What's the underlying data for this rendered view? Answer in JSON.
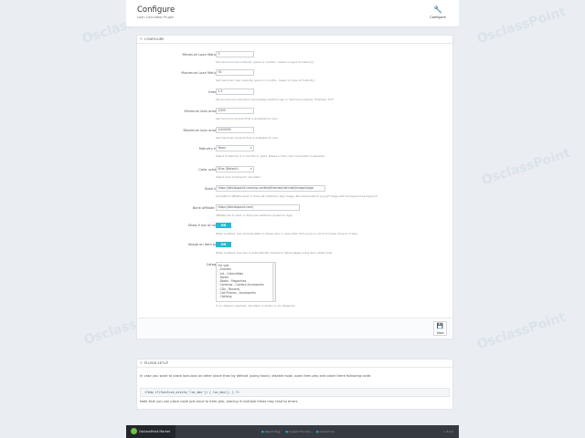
{
  "header": {
    "title": "Configure",
    "subtitle": "Loan Calculator Plugin",
    "configure_button": "Configure",
    "configure_icon": "wrench-icon"
  },
  "config": {
    "panel_title": "CONFIGURE",
    "fields": {
      "min_maturity": {
        "label": "Minimum Loan Maturity",
        "value": "5",
        "help": "Set minimum loan maturity (years or months - based on type of maturity)"
      },
      "max_maturity": {
        "label": "Maximum Loan Maturity",
        "value": "30",
        "help": "Set maximum loan maturity (years or months - based on type of maturity)"
      },
      "interest": {
        "label": "Interest",
        "value": "1.5",
        "help": "Set annual loan interest in percentage (without sign or decimal numbers). Example: 5.67"
      },
      "min_amount": {
        "label": "Minimum loan amount",
        "value": "1000",
        "help": "Set minimum amount that is available for loan"
      },
      "max_amount": {
        "label": "Maximum loan amount",
        "value": "1000000",
        "help": "Set maximum amount that is available for loan"
      },
      "maturity_type": {
        "label": "Maturity type",
        "value": "Years",
        "help": "Select if maturity is in months or years. Based on this, loan calculation is adjusted"
      },
      "color_scheme": {
        "label": "Color scheme",
        "value": "Blue (Default)",
        "help": "Select color scheme for calculator"
      },
      "bank_logo": {
        "label": "Bank logo",
        "value": "https://declaspoint.com/wp-content/themes/rainmak/images/logo",
        "help": "Link/URL to affiliate bank or financial institution logo image. Recommended to png gif image with transparent background"
      },
      "bank_affiliate": {
        "label": "Bank affiliate link",
        "value": "https://declaspoint.com/",
        "help": "Affiliate link to bank or financial institution (linked to logo)"
      },
      "show_out_of_range": {
        "label": "Show if out of range",
        "value": "ON",
        "help": "When enabled, loan box/calculator is shown also in case when item price is out of min/max amount of loan."
      },
      "image_on_item": {
        "label": "Image on item page",
        "value": "ON",
        "help": "When enabled, loan box is automatically hooked to listing pages using item_detail hook."
      },
      "category": {
        "label": "Category",
        "options": [
          "For sale",
          "- Animals",
          "- Art - Collectibles",
          "- Barter",
          "- Books - Magazines",
          "- Cameras - Camera Accessories",
          "- CDs - Records",
          "- Cell Phones - Accessories",
          "- Clothing"
        ],
        "help": "If no category selected, calculator is shown in all categories"
      }
    },
    "save_label": "Save",
    "save_icon": "floppy-disk-icon"
  },
  "setup": {
    "panel_title": "PLUGIN SETUP",
    "intro": "In case you want to place loan-box on other place than by default (using hook), disable hook, open item.php and place there following code:",
    "code": "<?php if(function_exists('loc_box')) { loc_box(); } ?>",
    "note": "Note that you can place code just once to item.php, placing it multiple times may lead to errors"
  },
  "footer": {
    "brand": "OsclassPoint Market",
    "links": [
      "Report Bug",
      "Support Forums",
      "Contact Us"
    ],
    "version": "v 3.0.0"
  },
  "watermark": "OsclassPoint",
  "colors": {
    "accent": "#25b9d7",
    "footer_bg": "#363a41",
    "logo": "#6fbf4b"
  }
}
